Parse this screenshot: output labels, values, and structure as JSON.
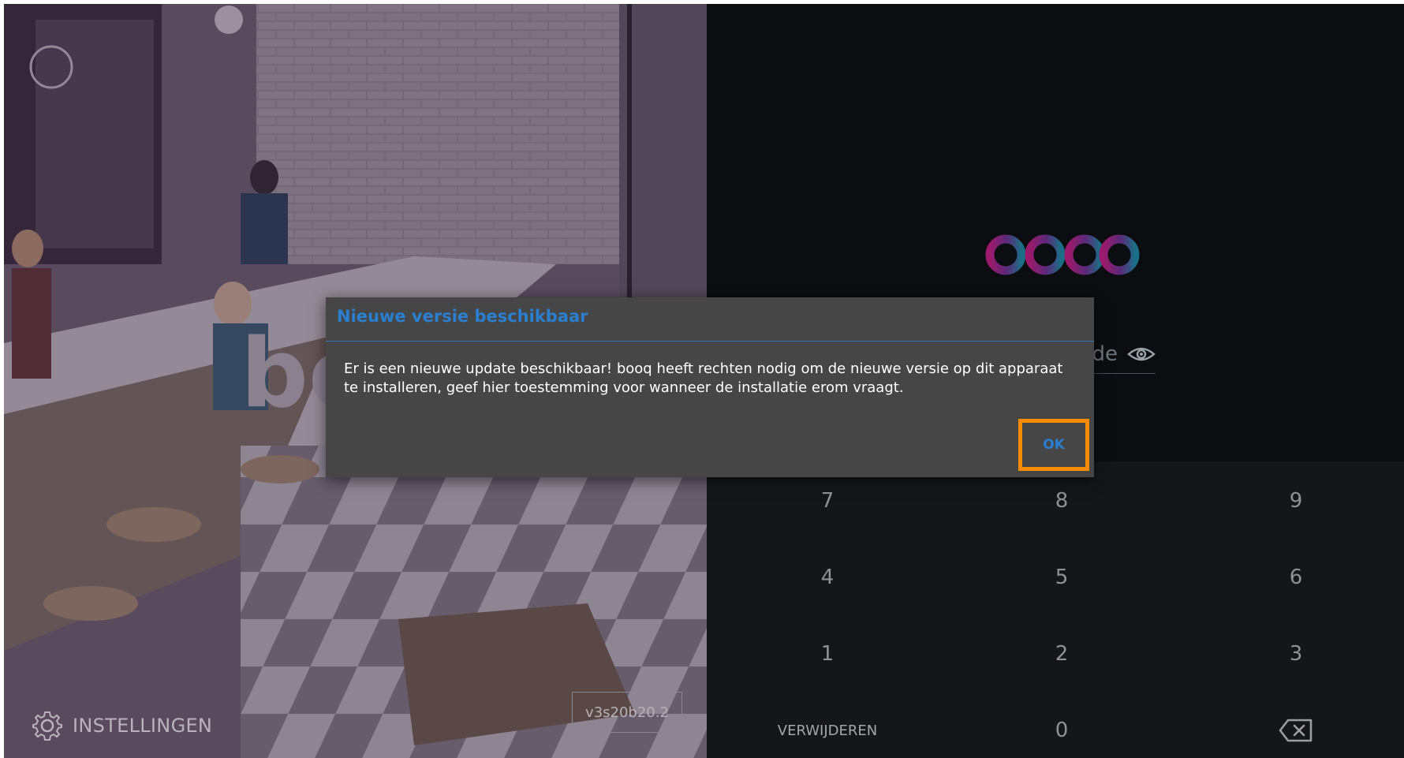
{
  "app": {
    "version": "v3s20b20.2",
    "settings_label": "INSTELLINGEN"
  },
  "login": {
    "pin_placeholder": "Pincode",
    "keypad": {
      "row1": [
        "7",
        "8",
        "9"
      ],
      "row2": [
        "4",
        "5",
        "6"
      ],
      "row3": [
        "1",
        "2",
        "3"
      ],
      "row4_left": "VERWIJDEREN",
      "row4_middle": "0"
    }
  },
  "dialog": {
    "title": "Nieuwe versie beschikbaar",
    "message": "Er is een nieuwe update beschikbaar! booq heeft rechten nodig om de nieuwe versie op dit apparaat te installeren, geef hier toestemming voor wanneer de installatie erom vraagt.",
    "ok_label": "OK"
  },
  "colors": {
    "accent_blue": "#2b7fd0",
    "highlight_orange": "#ff8c00",
    "dialog_bg": "#464646",
    "logo_magenta": "#9b1a6b",
    "logo_teal": "#1a6f86"
  },
  "icons": {
    "settings": "gear-icon",
    "show_pin": "eye-icon",
    "delete": "backspace-icon"
  }
}
